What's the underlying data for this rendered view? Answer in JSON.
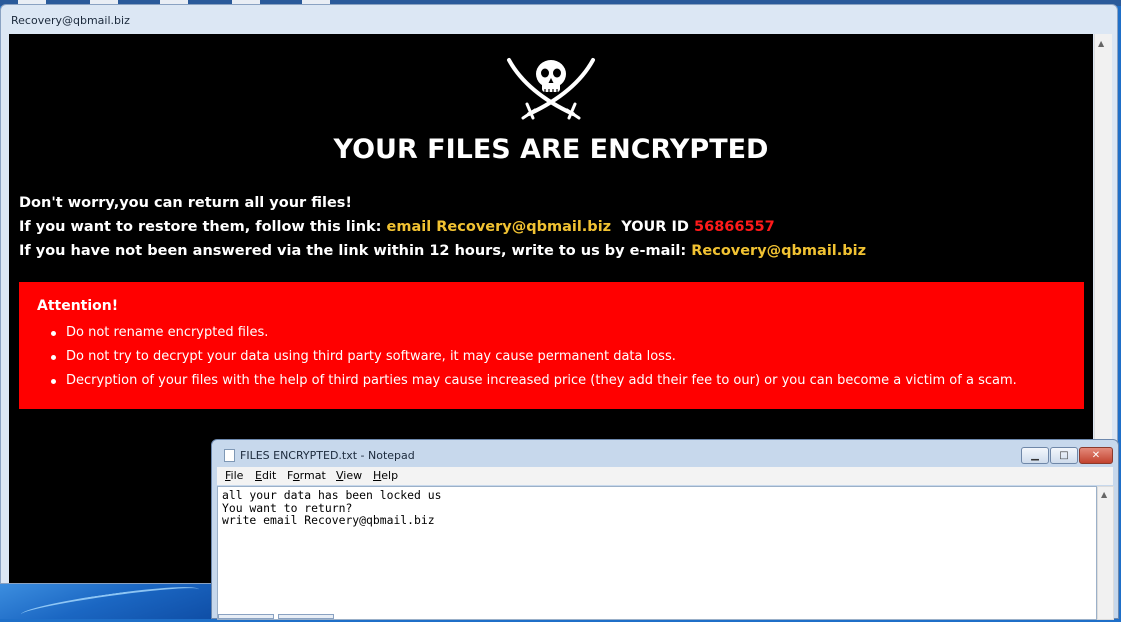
{
  "main_window": {
    "title": "Recovery@qbmail.biz"
  },
  "ransom_note": {
    "headline": "YOUR FILES ARE ENCRYPTED",
    "line1": "Don't worry,you can return all your files!",
    "line2_prefix": "If you want to restore them, follow this link:",
    "line2_link": "email Recovery@qbmail.biz",
    "line2_id_label": "YOUR ID",
    "line2_id_value": "56866557",
    "line3_prefix": "If you have not been answered via the link within 12 hours, write to us by e-mail:",
    "line3_email": "Recovery@qbmail.biz",
    "attention": {
      "title": "Attention!",
      "items": [
        "Do not rename encrypted files.",
        "Do not try to decrypt your data using third party software, it may cause permanent data loss.",
        "Decryption of your files with the help of third parties may cause increased price (they add their fee to our) or you can become a victim of a scam."
      ]
    },
    "logo_icon": "skull-crossed-swords-icon"
  },
  "notepad": {
    "title": "FILES ENCRYPTED.txt - Notepad",
    "menu": [
      "File",
      "Edit",
      "Format",
      "View",
      "Help"
    ],
    "content": "all your data has been locked us\nYou want to return?\nwrite email Recovery@qbmail.biz",
    "buttons": {
      "minimize": "minimize-icon",
      "maximize": "maximize-icon",
      "close": "close-icon"
    }
  },
  "colors": {
    "note_background": "#000000",
    "attention_background": "#ff0000",
    "highlight_yellow": "#f1c232",
    "id_red": "#ff1a1a"
  }
}
